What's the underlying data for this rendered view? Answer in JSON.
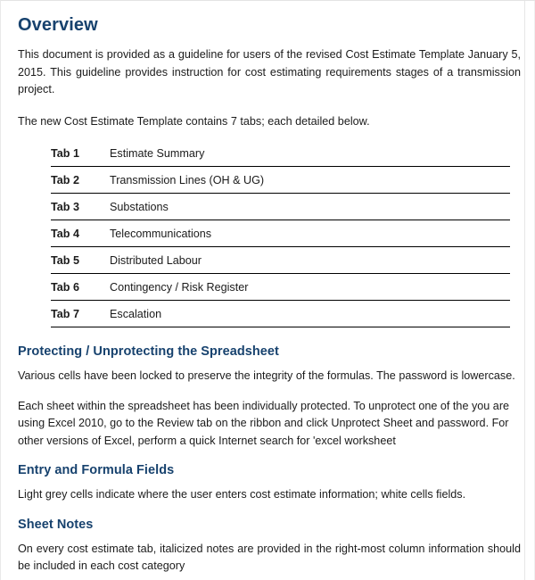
{
  "document": {
    "title": "Overview",
    "intro_paragraph": "This document is provided as a guideline for users of the revised Cost Estimate Template January 5, 2015. This guideline provides instruction for cost estimating requirements stages of a transmission project.",
    "tabs_intro": "The new Cost Estimate Template contains 7 tabs; each detailed below."
  },
  "tab_table": {
    "rows": [
      {
        "tab": "Tab 1",
        "description": "Estimate Summary"
      },
      {
        "tab": "Tab 2",
        "description": "Transmission Lines (OH & UG)"
      },
      {
        "tab": "Tab 3",
        "description": "Substations"
      },
      {
        "tab": "Tab 4",
        "description": "Telecommunications"
      },
      {
        "tab": "Tab 5",
        "description": "Distributed Labour"
      },
      {
        "tab": "Tab 6",
        "description": "Contingency / Risk Register"
      },
      {
        "tab": "Tab 7",
        "description": "Escalation"
      }
    ]
  },
  "sections": [
    {
      "heading": "Protecting / Unprotecting the Spreadsheet",
      "paragraph_1": "Various cells have been locked to preserve the integrity of the formulas.  The password is lowercase.",
      "paragraph_2": "Each sheet within the spreadsheet has been individually protected. To unprotect one of the you are using Excel 2010, go to the Review tab on the ribbon and click Unprotect Sheet and password. For other versions of Excel, perform a quick Internet search for 'excel worksheet"
    },
    {
      "heading": "Entry and Formula Fields",
      "paragraph_1": "Light grey cells indicate where the user enters cost estimate information; white cells fields."
    },
    {
      "heading": "Sheet Notes",
      "paragraph_1": "On every cost estimate tab, italicized notes are provided in the right-most column information should be included in each cost category"
    }
  ],
  "colors": {
    "heading": "#17426e",
    "body_text": "#1b1b1b",
    "rule": "#000000",
    "page_background": "#ffffff"
  }
}
